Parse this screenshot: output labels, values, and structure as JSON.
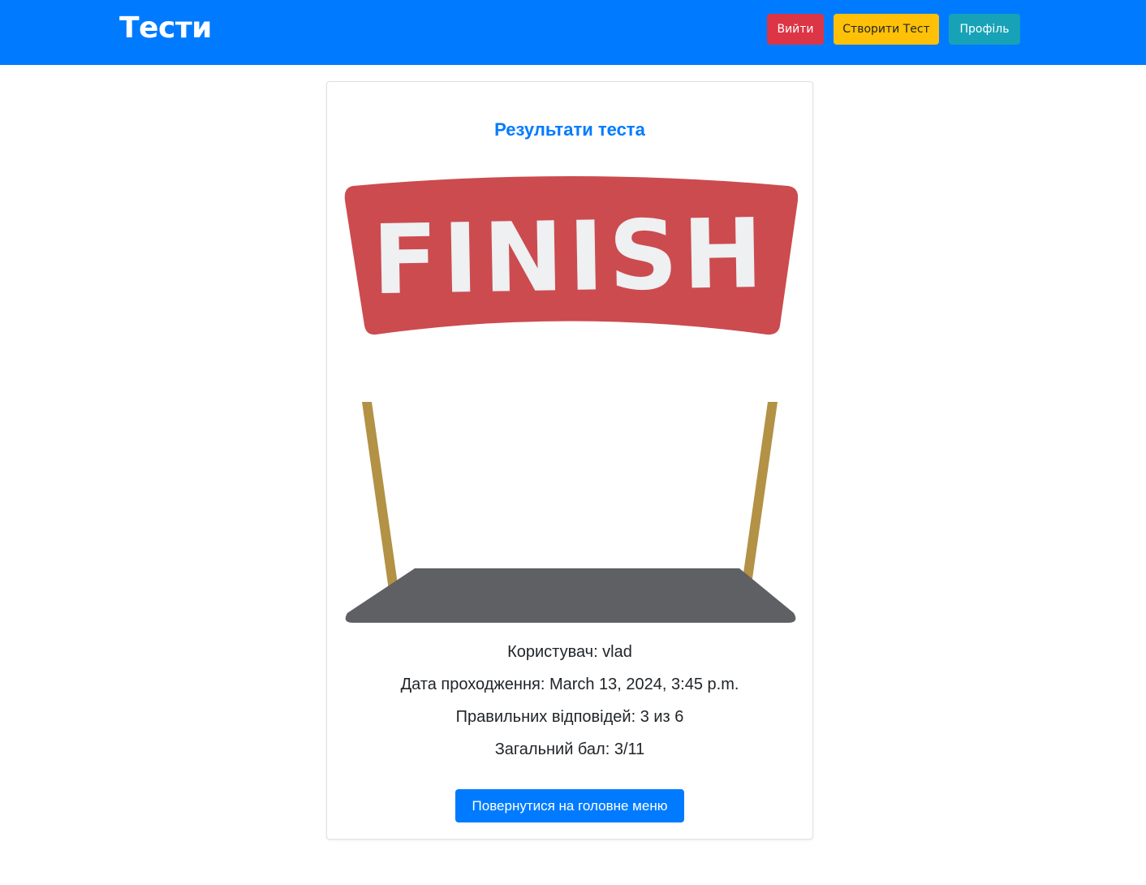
{
  "navbar": {
    "brand": "Тести",
    "buttons": {
      "logout": "Вийти",
      "create_test": "Створити Тест",
      "profile": "Профіль"
    },
    "colors": {
      "background": "#007bff",
      "logout": "#dc3545",
      "create_test": "#ffc107",
      "profile": "#17a2b8"
    }
  },
  "card": {
    "title": "Результати теста",
    "illustration": {
      "banner_text": "FINISH",
      "icon": "finish-line-icon",
      "colors": {
        "banner": "#cc4b4f",
        "banner_text": "#eef0f2",
        "poles": "#b39145",
        "floor": "#5f6064",
        "checker_dark": "#2e2f36",
        "checker_light": "#e6e7e9"
      }
    },
    "info": {
      "user": "Користувач: vlad",
      "date": "Дата проходження: March 13, 2024, 3:45 p.m.",
      "correct_answers": "Правильних відповідей: 3 из 6",
      "total_score": "Загальний бал: 3/11"
    },
    "home_button": "Повернутися на головне меню"
  }
}
